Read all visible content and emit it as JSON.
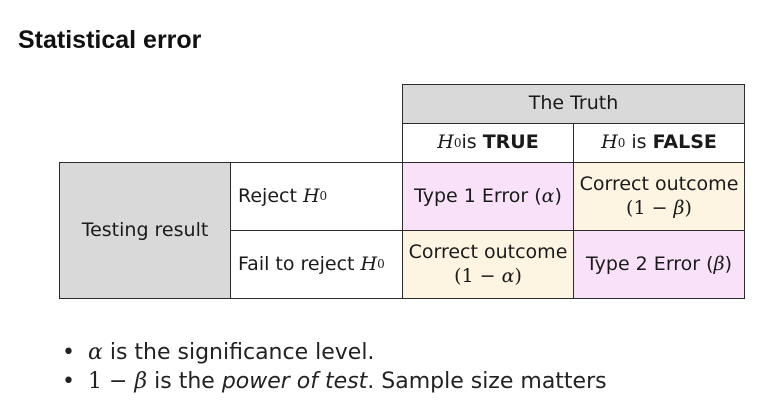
{
  "title": "Statistical error",
  "table": {
    "truth_header": "The Truth",
    "h0_true": {
      "symbol": "H",
      "sub": "0",
      "suffix": "is",
      "bold": "TRUE"
    },
    "h0_false": {
      "symbol": "H",
      "sub": "0",
      "suffix": "is",
      "bold": "FALSE"
    },
    "testing_result": "Testing result",
    "reject": {
      "text": "Reject",
      "symbol": "H",
      "sub": "0"
    },
    "fail_reject": {
      "text": "Fail to reject",
      "symbol": "H",
      "sub": "0"
    },
    "cells": {
      "type1": {
        "text": "Type 1 Error (",
        "sym": "α",
        "close": ")"
      },
      "correct1": {
        "line1": "Correct outcome",
        "line2_open": "(1 − ",
        "sym": "β",
        "line2_close": ")"
      },
      "correct2": {
        "line1": "Correct outcome",
        "line2_open": "(1 − ",
        "sym": "α",
        "line2_close": ")"
      },
      "type2": {
        "text": "Type 2 Error (",
        "sym": "β",
        "close": ")"
      }
    },
    "colors": {
      "header": "#d9d9d9",
      "error": "#f9e2f9",
      "correct": "#fdf4e1"
    }
  },
  "bullets": [
    {
      "sym": "α",
      "text": " is the significance level."
    },
    {
      "pre": "1 − ",
      "sym": "β",
      "mid": " is the ",
      "em": "power of test",
      "post": ". Sample size matters"
    }
  ]
}
